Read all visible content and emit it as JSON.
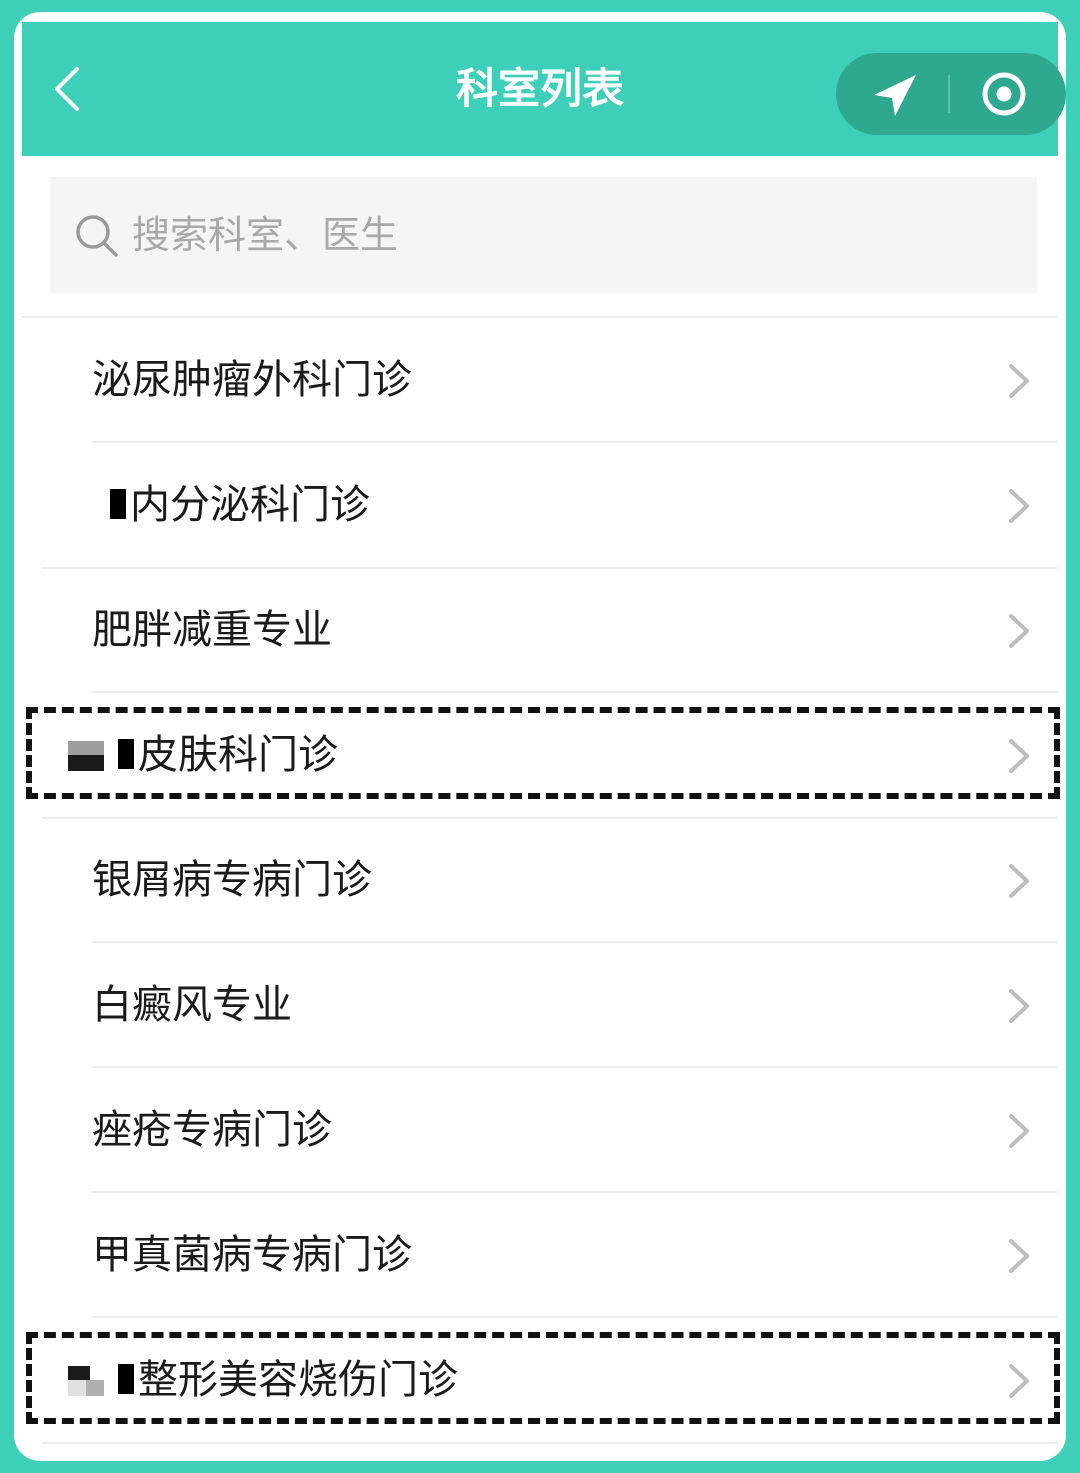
{
  "header": {
    "title": "科室列表",
    "back_icon": "chevron-left-icon",
    "capsule": [
      "navigation-arrow-icon",
      "record-circle-icon"
    ]
  },
  "search": {
    "placeholder": "搜索科室、医生",
    "icon": "search-icon"
  },
  "departments": [
    "泌尿肿瘤外科门诊",
    "内分泌科门诊",
    "肥胖减重专业",
    "皮肤科门诊",
    "银屑病专病门诊",
    "白癜风专业",
    "痤疮专病门诊",
    "甲真菌病专病门诊",
    "整形美容烧伤门诊"
  ],
  "colors": {
    "brand": "#3ecfb9",
    "capsule": "#2ea98f",
    "highlight_border": "#111111"
  }
}
